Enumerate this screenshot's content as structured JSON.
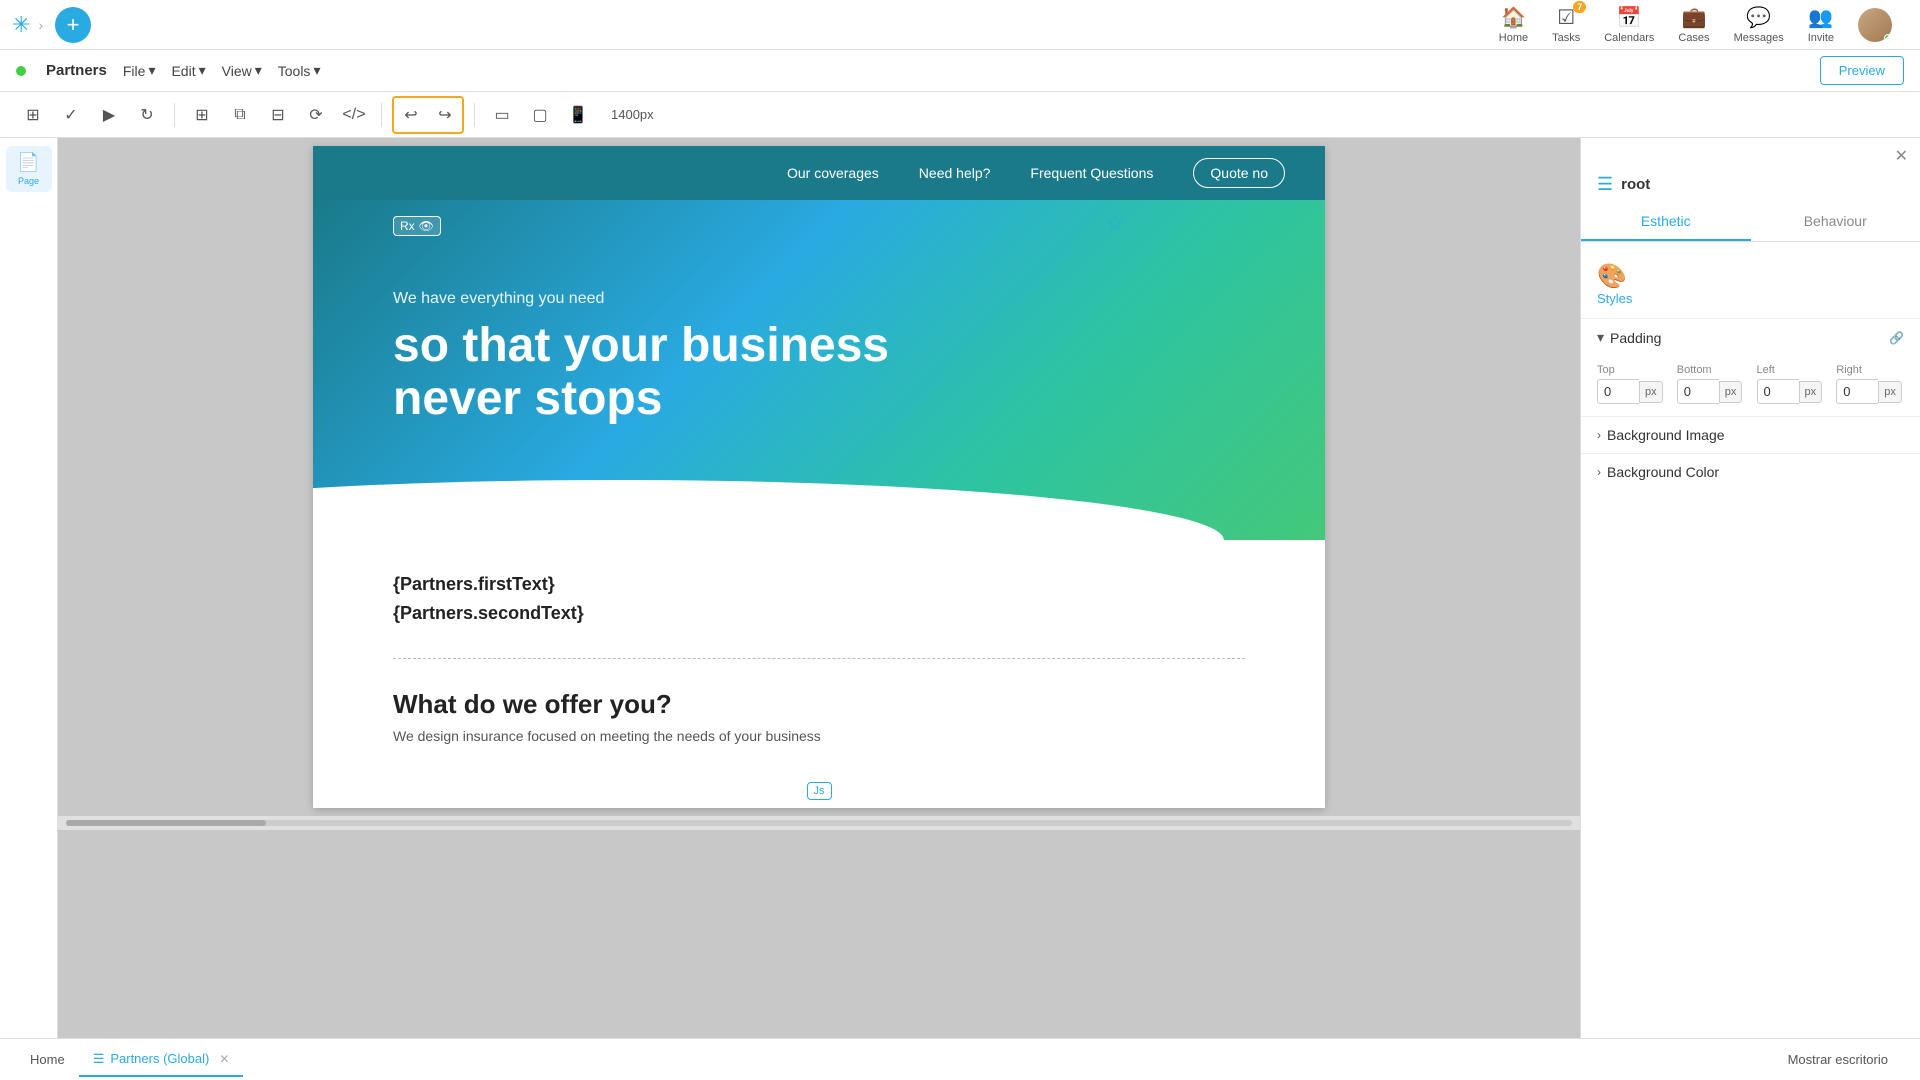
{
  "topbar": {
    "plus_label": "+",
    "nav_items": [
      {
        "id": "home",
        "icon": "🏠",
        "label": "Home",
        "badge": null
      },
      {
        "id": "tasks",
        "icon": "✓",
        "label": "Tasks",
        "badge": "7"
      },
      {
        "id": "calendars",
        "icon": "📅",
        "label": "Calendars",
        "badge": null
      },
      {
        "id": "cases",
        "icon": "💼",
        "label": "Cases",
        "badge": null
      },
      {
        "id": "messages",
        "icon": "💬",
        "label": "Messages",
        "badge": null
      },
      {
        "id": "invite",
        "icon": "👥",
        "label": "Invite",
        "badge": null
      }
    ]
  },
  "secondbar": {
    "partner_name": "Partners",
    "menus": [
      "File",
      "Edit",
      "View",
      "Tools"
    ],
    "preview_label": "Preview"
  },
  "toolbar": {
    "size_label": "1400px"
  },
  "left_sidebar": {
    "items": [
      {
        "id": "page",
        "icon": "📄",
        "label": "Page",
        "active": true
      }
    ]
  },
  "canvas": {
    "nav_items": [
      "Our coverages",
      "Need help?",
      "Frequent Questions",
      "Quote no"
    ],
    "hero_rx": "Rx",
    "hero_tagline": "We have everything you need",
    "hero_title": "so that your business\nnever stops",
    "content_text1": "{Partners.firstText}",
    "content_text2": "{Partners.secondText}",
    "offer_title": "What do we offer you?",
    "offer_desc": "We design insurance focused on meeting the needs of your business"
  },
  "right_panel": {
    "root_label": "root",
    "tabs": [
      {
        "id": "esthetic",
        "label": "Esthetic",
        "active": true
      },
      {
        "id": "behaviour",
        "label": "Behaviour",
        "active": false
      }
    ],
    "styles_label": "Styles",
    "padding": {
      "title": "Padding",
      "fields": [
        {
          "id": "top",
          "label": "Top",
          "value": "0",
          "unit": "px"
        },
        {
          "id": "bottom",
          "label": "Bottom",
          "value": "0",
          "unit": "px"
        },
        {
          "id": "left",
          "label": "Left",
          "value": "0",
          "unit": "px"
        },
        {
          "id": "right",
          "label": "Right",
          "value": "0",
          "unit": "px"
        }
      ]
    },
    "bg_image_label": "Background Image",
    "bg_color_label": "Background Color",
    "close_icon": "✕"
  },
  "bottombar": {
    "home_label": "Home",
    "tabs": [
      {
        "id": "partners",
        "label": "Partners (Global)",
        "closeable": true,
        "active": true
      }
    ],
    "mostrar_label": "Mostrar escritorio"
  }
}
